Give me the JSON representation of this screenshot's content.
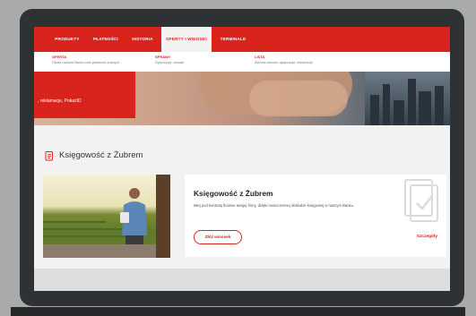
{
  "nav": {
    "items": [
      {
        "label": "PRODUKTY"
      },
      {
        "label": "PŁATNOŚCI"
      },
      {
        "label": "HISTORIA"
      },
      {
        "label": "OFERTY I WNIOSKI"
      },
      {
        "label": "TERMINALE"
      }
    ],
    "active_index": 3
  },
  "dropdown": {
    "columns": [
      {
        "title": "OFERTA",
        "desc": "Oferta i wnioski Banku oraz partnerów znanych..."
      },
      {
        "title": "SPRAWY",
        "desc": "Dyspozycje, wnioski"
      },
      {
        "title": "LISTA",
        "desc": "Złożone wnioski, dyspozycje, reklamacje"
      }
    ]
  },
  "hero": {
    "text": ", reklamacje, PokażID"
  },
  "section": {
    "title": "Księgowość z Żubrem"
  },
  "card": {
    "title": "Księgowość z Żubrem",
    "desc": "Miej pod kontrolą finanse swojej firmy, dzięki nowoczesnej obsłudze księgowej w naszym Banku.",
    "button_label": "Złóż wniosek",
    "link_label": "Szczegóły"
  },
  "colors": {
    "accent": "#d9241d",
    "nav_bg": "#d9241d",
    "page_bg": "#f2f2f2",
    "bezel": "#2f3234"
  }
}
